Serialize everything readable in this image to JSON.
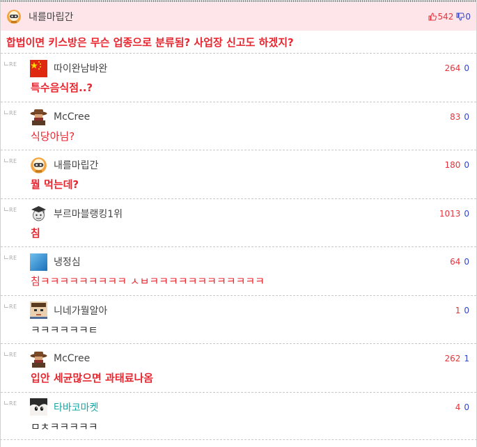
{
  "main": {
    "author": "내를마립간",
    "avatar_icon": "astronaut-icon",
    "upvotes": "542",
    "downvotes": "0",
    "content": "합법이면 키스방은 무슨 업종으로 분류됨? 사업장 신고도 하겠지?"
  },
  "re_label": "RE",
  "replies": [
    {
      "author": "따이완남바완",
      "avatar_icon": "china-flag-icon",
      "up": "264",
      "down": "0",
      "content": "특수음식점..?",
      "style": "red-bold"
    },
    {
      "author": "McCree",
      "avatar_icon": "cowboy-icon",
      "up": "83",
      "down": "0",
      "content": "식당아님?",
      "style": "red"
    },
    {
      "author": "내를마립간",
      "avatar_icon": "astronaut-icon",
      "up": "180",
      "down": "0",
      "content": "뭘 먹는데?",
      "style": "red-bold"
    },
    {
      "author": "부르마블랭킹1위",
      "avatar_icon": "graduate-icon",
      "up": "1013",
      "down": "0",
      "content": "침",
      "style": "red-bold"
    },
    {
      "author": "냉정심",
      "avatar_icon": "blue-square-icon",
      "up": "64",
      "down": "0",
      "content": "침ㅋㅋㅋㅋㅋㅋㅋㅋㅋ ㅅㅂㅋㅋㅋㅋㅋㅋㅋㅋㅋㅋㅋㅋ",
      "style": "red"
    },
    {
      "author": "니네가뭘알아",
      "avatar_icon": "pixel-face-icon",
      "up": "1",
      "down": "0",
      "content": "ㅋㅋㅋㅋㅋㅋㅌ",
      "style": "plain"
    },
    {
      "author": "McCree",
      "avatar_icon": "cowboy-icon",
      "up": "262",
      "down": "1",
      "content": "입안 세균많으면 과태료나옴",
      "style": "red-bold"
    },
    {
      "author": "타바코마켓",
      "avatar_icon": "anime-face-icon",
      "up": "4",
      "down": "0",
      "content": "ㅁㅊㅋㅋㅋㅋㅋ",
      "style": "plain",
      "name_style": "teal"
    }
  ],
  "colors": {
    "header_bg": "#fde5ea",
    "accent_red": "#e8262f",
    "down_blue": "#3344cc",
    "teal_name": "#14a6a6"
  }
}
